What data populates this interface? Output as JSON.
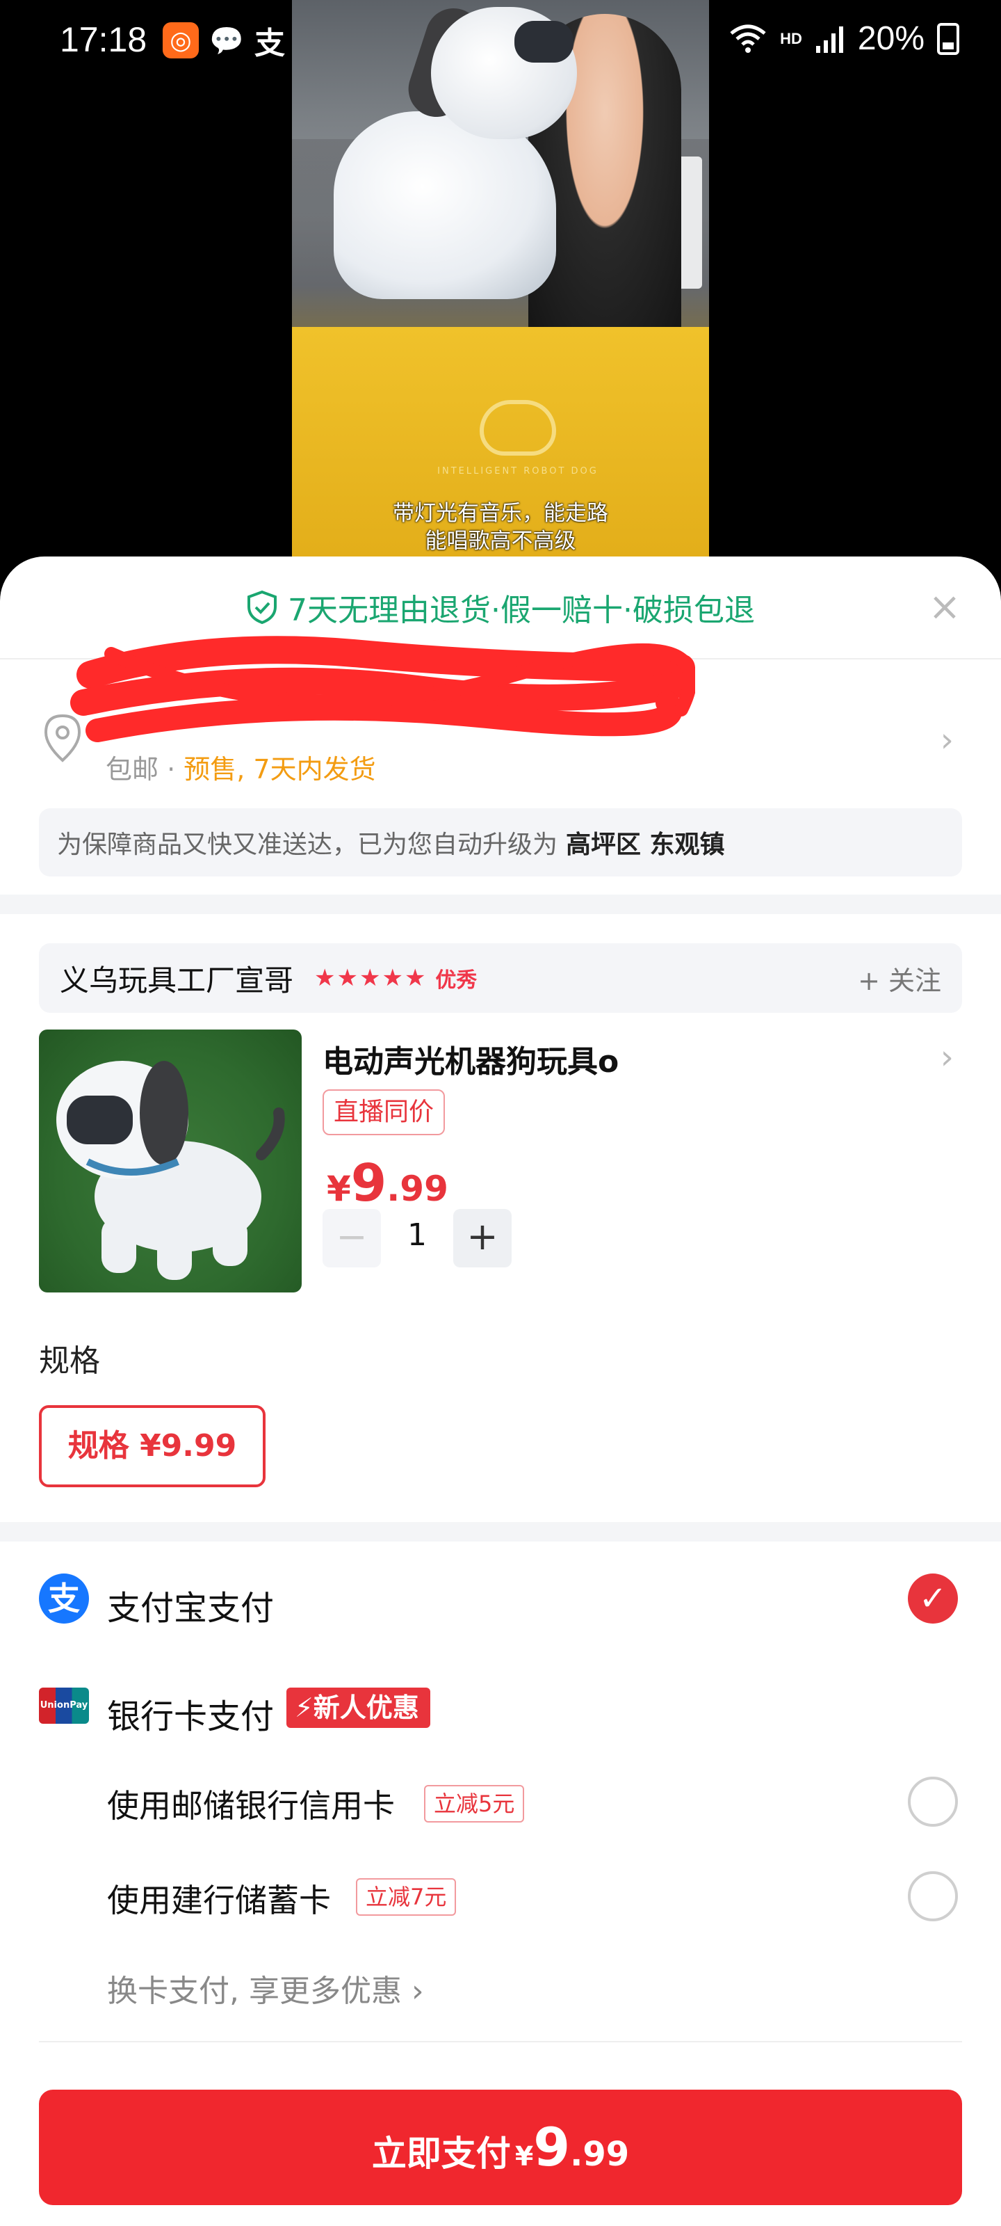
{
  "status_bar": {
    "time": "17:18",
    "hd": "HD",
    "battery": "20%"
  },
  "video": {
    "box_text": "INTELLIGENT ROBOT DOG",
    "subtitle_line1": "带灯光有音乐，能走路",
    "subtitle_line2": "能唱歌高不高级"
  },
  "guarantee": {
    "text": "7天无理由退货·假一赔十·破损包退"
  },
  "shipping": {
    "free": "包邮 · ",
    "presale": "预售, 7天内发货"
  },
  "upgrade_note": {
    "text": "为保障商品又快又准送达，已为您自动升级为",
    "location": "高坪区 东观镇"
  },
  "shop": {
    "name": "义乌玩具工厂宣哥",
    "stars": "★★★★★",
    "badge": "优秀",
    "follow": "+ 关注"
  },
  "product": {
    "title": "电动声光机器狗玩具o",
    "tag": "直播同价",
    "price_currency": "¥",
    "price_int": "9",
    "price_dec": ".99",
    "qty": "1"
  },
  "spec": {
    "label": "规格",
    "option": "规格 ¥9.99"
  },
  "payment": {
    "alipay": "支付宝支付",
    "bank": "银行卡支付",
    "new_user": "新人优惠",
    "cards": [
      {
        "label": "使用邮储银行信用卡",
        "discount": "立减5元"
      },
      {
        "label": "使用建行储蓄卡",
        "discount": "立减7元"
      }
    ],
    "more": "换卡支付, 享更多优惠 ›"
  },
  "pay_button": {
    "label": "立即支付",
    "currency": "¥",
    "int": "9",
    "dec": ".99"
  },
  "colors": {
    "accent_red": "#e8343c",
    "green": "#1aa670",
    "alipay_blue": "#1677ff"
  }
}
